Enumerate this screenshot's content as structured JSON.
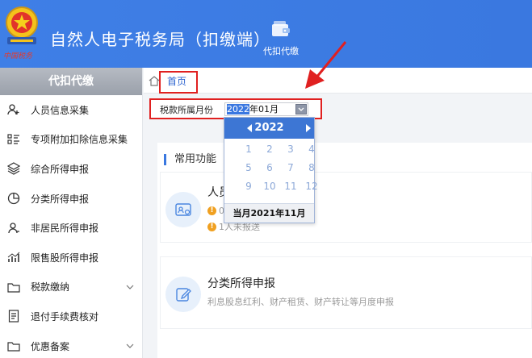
{
  "header": {
    "title": "自然人电子税务局（扣缴端）",
    "emblem_motto": "中国税务",
    "nav_tab_label": "代扣代缴"
  },
  "sidebar": {
    "heading": "代扣代缴",
    "items": [
      {
        "label": "人员信息采集",
        "icon": "person-add-icon"
      },
      {
        "label": "专项附加扣除信息采集",
        "icon": "list-icon"
      },
      {
        "label": "综合所得申报",
        "icon": "layers-icon"
      },
      {
        "label": "分类所得申报",
        "icon": "pie-chart-icon"
      },
      {
        "label": "非居民所得申报",
        "icon": "person-icon"
      },
      {
        "label": "限售股所得申报",
        "icon": "bar-chart-icon"
      },
      {
        "label": "税款缴纳",
        "icon": "folder-icon"
      },
      {
        "label": "退付手续费核对",
        "icon": "document-icon"
      },
      {
        "label": "优惠备案",
        "icon": "folder-icon"
      }
    ]
  },
  "breadcrumb": {
    "home": "首页"
  },
  "period": {
    "label": "税款所属月份",
    "year_selected": "2022",
    "rest": "年01月"
  },
  "panel": {
    "title": "常用功能",
    "card1": {
      "title": "人员",
      "line1": "0",
      "line2": "1人未报送"
    },
    "card2": {
      "title": "分类所得申报",
      "desc": "利息股息红利、财产租赁、财产转让等月度申报"
    }
  },
  "picker": {
    "year": "2022",
    "months": [
      "1",
      "2",
      "3",
      "4",
      "5",
      "6",
      "7",
      "8",
      "9",
      "10",
      "11",
      "12"
    ],
    "current_label": "当月2021年11月"
  },
  "colors": {
    "header_blue": "#3f7fe6",
    "annotation_red": "#e02020",
    "picker_blue": "#3d76d4"
  }
}
